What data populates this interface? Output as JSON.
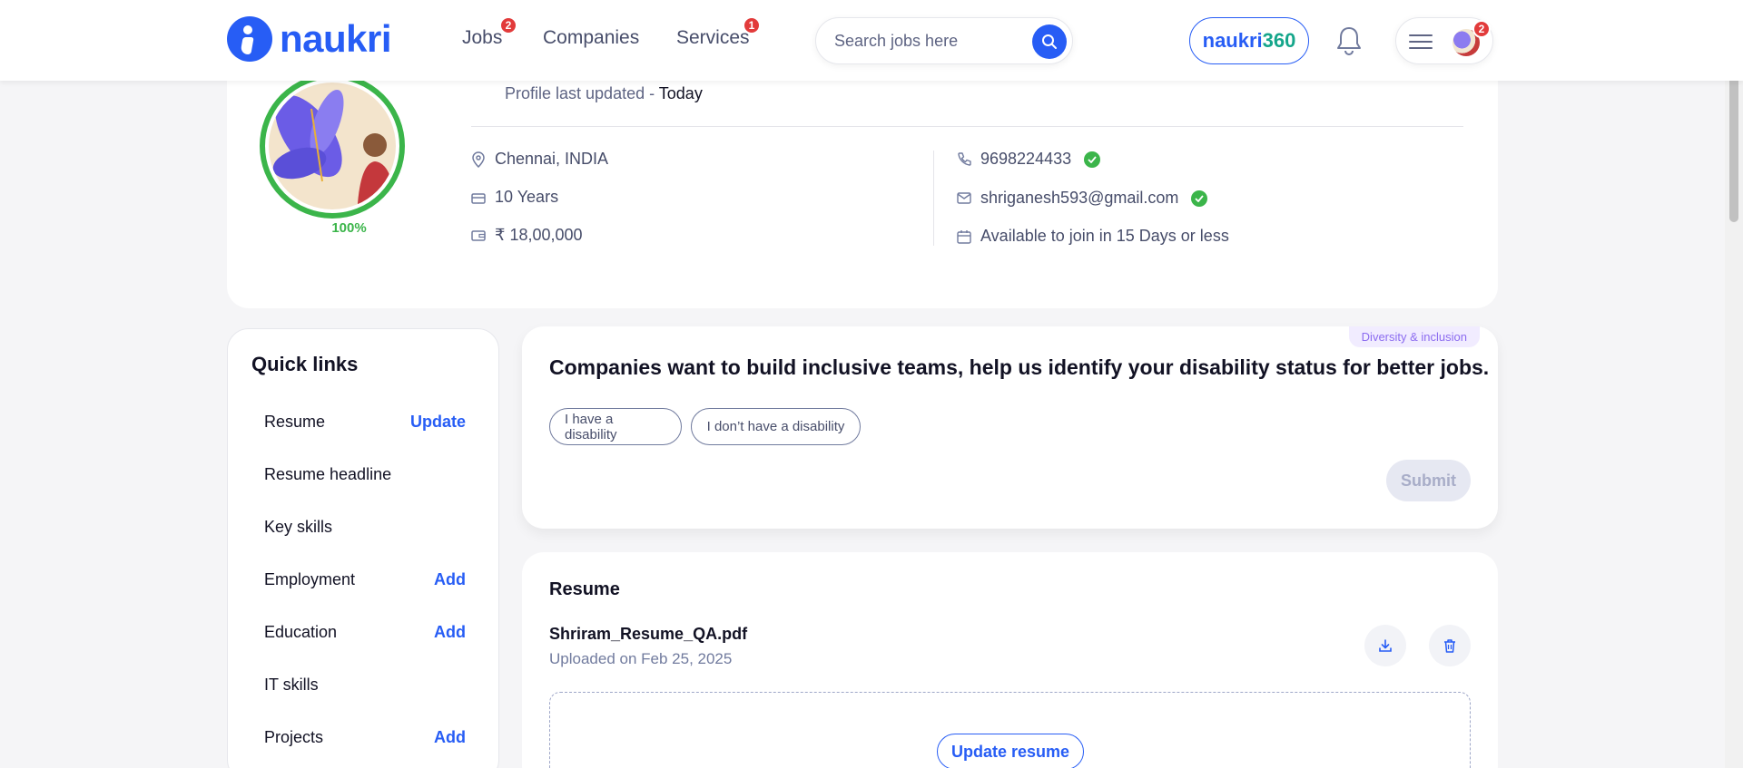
{
  "header": {
    "logo_text": "naukri",
    "nav": [
      {
        "label": "Jobs",
        "badge": "2"
      },
      {
        "label": "Companies"
      },
      {
        "label": "Services",
        "badge": "1"
      }
    ],
    "search_placeholder": "Search jobs here",
    "naukri360_a": "naukri",
    "naukri360_b": "360",
    "profile_badge": "2"
  },
  "profile": {
    "completion": "100%",
    "completion_value": 1.0,
    "updated_label": "Profile last updated - ",
    "updated_value": "Today",
    "location": "Chennai, INDIA",
    "experience": "10 Years",
    "salary": "₹ 18,00,000",
    "phone": "9698224433",
    "email": "shriganesh593@gmail.com",
    "availability": "Available to join in 15 Days or less"
  },
  "quick_links": {
    "title": "Quick links",
    "items": [
      {
        "label": "Resume",
        "action": "Update"
      },
      {
        "label": "Resume headline",
        "action": ""
      },
      {
        "label": "Key skills",
        "action": ""
      },
      {
        "label": "Employment",
        "action": "Add"
      },
      {
        "label": "Education",
        "action": "Add"
      },
      {
        "label": "IT skills",
        "action": ""
      },
      {
        "label": "Projects",
        "action": "Add"
      }
    ]
  },
  "diversity": {
    "tag": "Diversity & inclusion",
    "title": "Companies want to build inclusive teams, help us identify your disability status for better jobs.",
    "option_yes": "I have a disability",
    "option_no": "I don’t have a disability",
    "submit": "Submit"
  },
  "resume": {
    "title": "Resume",
    "file_name": "Shriram_Resume_QA.pdf",
    "uploaded": "Uploaded on Feb 25, 2025",
    "update_button": "Update resume"
  },
  "colors": {
    "brand": "#275df5",
    "success": "#3bb54a",
    "badge": "#e23b3b"
  }
}
